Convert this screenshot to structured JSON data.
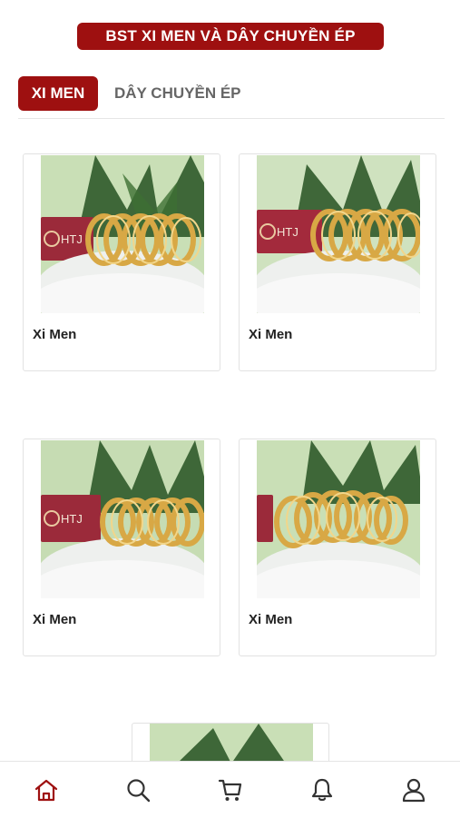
{
  "header": {
    "banner_title": "BST XI MEN VÀ DÂY CHUYỀN ÉP"
  },
  "tabs": [
    {
      "label": "XI MEN",
      "active": true
    },
    {
      "label": "DÂY CHUYỀN ÉP",
      "active": false
    }
  ],
  "products": [
    {
      "name": "Xi Men",
      "image": "gold-bangles-photo",
      "brand_text": "HTJ"
    },
    {
      "name": "Xi Men",
      "image": "gold-bangles-photo",
      "brand_text": "HTJ"
    },
    {
      "name": "Xi Men",
      "image": "gold-bangles-photo",
      "brand_text": "HTJ"
    },
    {
      "name": "Xi Men",
      "image": "gold-bangles-photo",
      "brand_text": ""
    }
  ],
  "bottom_nav": [
    {
      "icon": "home-icon",
      "active": true
    },
    {
      "icon": "search-icon",
      "active": false
    },
    {
      "icon": "cart-icon",
      "active": false
    },
    {
      "icon": "bell-icon",
      "active": false
    },
    {
      "icon": "user-icon",
      "active": false
    }
  ],
  "colors": {
    "accent": "#9e1010",
    "inactive_tab": "#666666",
    "icon": "#333333"
  }
}
